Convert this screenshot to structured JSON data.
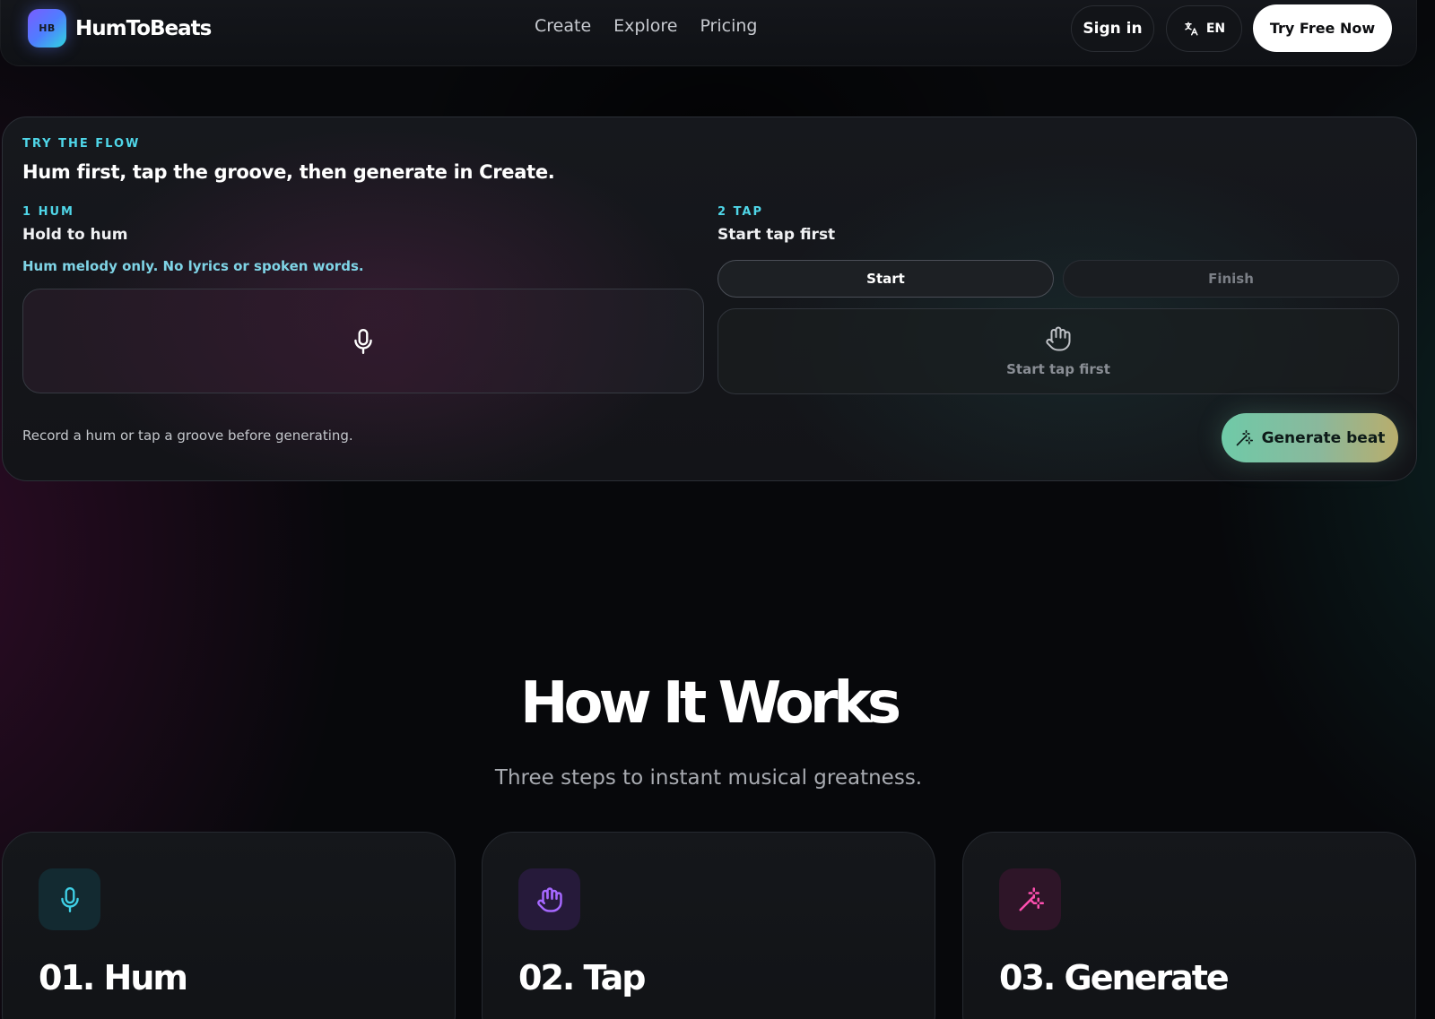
{
  "nav": {
    "logo_badge": "HB",
    "logo_text": "HumToBeats",
    "links": [
      "Create",
      "Explore",
      "Pricing"
    ],
    "sign_in": "Sign in",
    "lang": "EN",
    "try_free": "Try Free Now"
  },
  "flow": {
    "eyebrow": "TRY THE FLOW",
    "title": "Hum first, tap the groove, then generate in Create.",
    "hum": {
      "label": "1 HUM",
      "title": "Hold to hum",
      "hint": "Hum melody only. No lyrics or spoken words."
    },
    "tap": {
      "label": "2 TAP",
      "title": "Start tap first",
      "start": "Start",
      "finish": "Finish",
      "box_text": "Start tap first"
    },
    "note": "Record a hum or tap a groove before generating.",
    "generate": "Generate beat"
  },
  "how": {
    "title": "How It Works",
    "subtitle": "Three steps to instant musical greatness.",
    "cards": [
      {
        "title": "01. Hum",
        "icon": "mic-icon",
        "color": "#3fd0e6"
      },
      {
        "title": "02. Tap",
        "icon": "hand-icon",
        "color": "#a668ff"
      },
      {
        "title": "03. Generate",
        "icon": "magic-wand-icon",
        "color": "#ff4fb0"
      }
    ]
  },
  "colors": {
    "accent_cyan": "#4fd6e8",
    "background": "#07080b"
  }
}
